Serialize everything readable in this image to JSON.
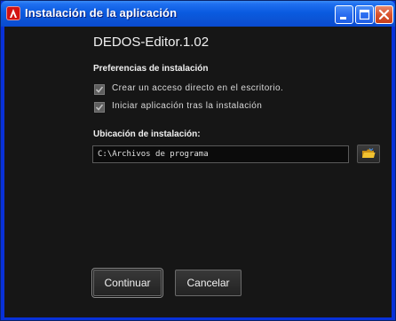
{
  "window": {
    "title": "Instalación de la aplicación"
  },
  "app": {
    "name_version": "DEDOS-Editor.1.02"
  },
  "preferences": {
    "heading": "Preferencias de instalación",
    "options": [
      {
        "label": "Crear un acceso directo en el escritorio.",
        "checked": true
      },
      {
        "label": "Iniciar aplicación tras la instalación",
        "checked": true
      }
    ]
  },
  "location": {
    "heading": "Ubicación de instalación:",
    "path": "C:\\Archivos de programa"
  },
  "buttons": {
    "continue_label": "Continuar",
    "cancel_label": "Cancelar"
  },
  "colors": {
    "titlebar": "#0a5be0",
    "frame": "#0831d9",
    "close_button": "#d9532e",
    "content_bg": "#161616",
    "folder_icon": "#f2c230"
  },
  "icons": {
    "app": "adobe-air-icon",
    "minimize": "minimize-icon",
    "maximize": "maximize-icon",
    "close": "close-icon",
    "checkbox": "checkmark-icon",
    "browse": "folder-icon"
  }
}
